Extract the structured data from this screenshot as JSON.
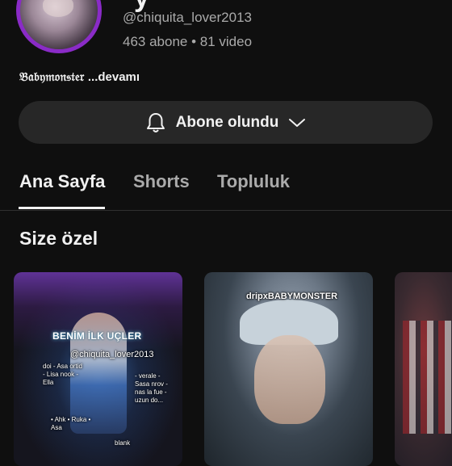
{
  "channel": {
    "name_fragment": "y",
    "avatar_caption": "",
    "handle": "@chiquita_lover2013",
    "stats": "463 abone • 81 video",
    "bio_text": "𝔅𝔞𝔟𝔶𝔪𝔬𝔫𝔰𝔱𝔢𝔯",
    "bio_more": "...devamı"
  },
  "subscribe_button": {
    "label": "Abone olundu",
    "icon": "bell-icon",
    "chevron": "chevron-down-icon"
  },
  "tabs": [
    {
      "label": "Ana Sayfa",
      "active": true
    },
    {
      "label": "Shorts",
      "active": false
    },
    {
      "label": "Topluluk",
      "active": false
    }
  ],
  "section": {
    "title": "Size özel"
  },
  "cards": [
    {
      "title_overlay": "BENİM İLK UÇLER",
      "handle_overlay": "@chiquita_lover2013",
      "side_note_left": "doi\n- Asa ortid\n- Lisa nook\n- Ella",
      "side_note_right": "- verale\n- Sasa nrov\n- nas la fue\n- uzun do...",
      "bottom_left": "• Ahk\n• Ruka\n• Asa",
      "bottom_right": "blank"
    },
    {
      "tag_overlay": "dripxBABYMONSTER"
    },
    {}
  ],
  "colors": {
    "background": "#0f0f0f",
    "button_bg": "#272727",
    "secondary_text": "#aaaaaa",
    "primary_text": "#f1f1f1",
    "avatar_ring": "#8a2bc7"
  }
}
